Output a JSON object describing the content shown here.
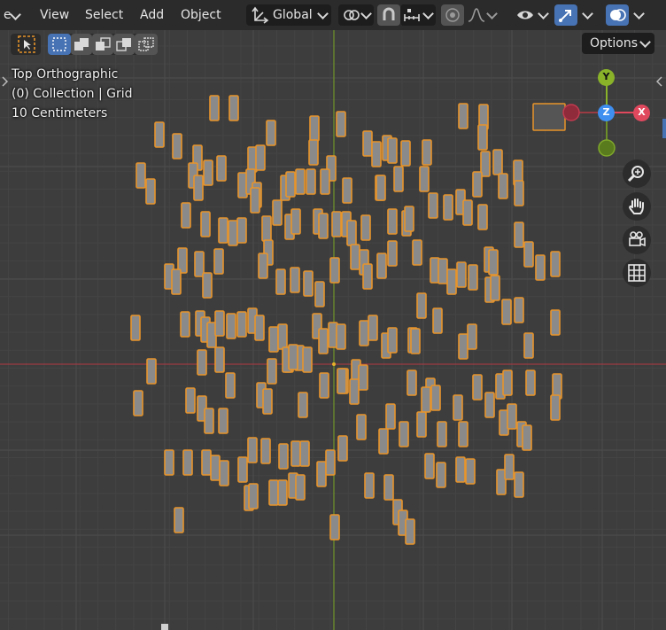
{
  "header": {
    "partial_menu": "e",
    "menus": [
      "View",
      "Select",
      "Add",
      "Object"
    ],
    "transform_orientation": "Global",
    "options_label": "Options"
  },
  "overlay": {
    "view_name": "Top Orthographic",
    "collection": "(0) Collection | Grid",
    "scale": "10 Centimeters"
  },
  "gizmo": {
    "y_label": "Y",
    "z_label": "Z",
    "x_label": "X"
  },
  "icons": {
    "cursor": "select-cursor-icon",
    "zoom": "zoom-icon",
    "pan": "hand-pan-icon",
    "camera": "camera-icon",
    "ortho": "grid-ortho-icon"
  },
  "colors": {
    "viewport_bg": "#3d3d3d",
    "grid_line": "#484848",
    "x_axis": "#9a3b43",
    "y_axis": "#6c8f2a",
    "selection_orange": "#e8942a",
    "object_fill": "#8a8a8a",
    "accent_blue": "#4772b3"
  }
}
